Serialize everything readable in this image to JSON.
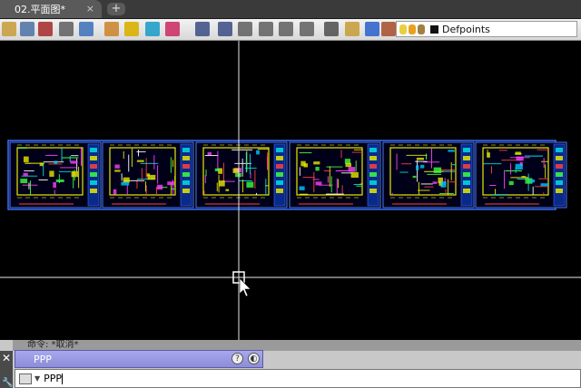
{
  "tabs": {
    "document_tab": "02.平面图*",
    "close_glyph": "×",
    "new_tab_glyph": "+"
  },
  "toolbar": {
    "buttons": [
      {
        "name": "open-icon",
        "color": "#c8a040"
      },
      {
        "name": "save-icon",
        "color": "#5577aa"
      },
      {
        "name": "block-icon",
        "color": "#aa3333"
      },
      {
        "name": "properties-icon",
        "color": "#666666"
      },
      {
        "name": "table-icon",
        "color": "#4477bb"
      },
      {
        "name": "edit-icon",
        "color": "#cc8833"
      },
      {
        "name": "text-icon",
        "color": "#d8b000"
      },
      {
        "name": "hatch-icon",
        "color": "#22a0c8"
      },
      {
        "name": "image-icon",
        "color": "#cc3366"
      },
      {
        "name": "undo-icon",
        "color": "#445588"
      },
      {
        "name": "redo-icon",
        "color": "#445588"
      },
      {
        "name": "pan-icon",
        "color": "#666666"
      },
      {
        "name": "zoom-icon",
        "color": "#666666"
      },
      {
        "name": "zoom-window-icon",
        "color": "#666666"
      },
      {
        "name": "zoom-previous-icon",
        "color": "#666666"
      },
      {
        "name": "sheet-icon",
        "color": "#555555"
      },
      {
        "name": "layer-props-icon",
        "color": "#c8a040"
      },
      {
        "name": "library-icon",
        "color": "#3366cc"
      },
      {
        "name": "layer-states-icon",
        "color": "#aa5533"
      }
    ],
    "layer_icons": [
      {
        "name": "bulb-icon",
        "color": "#e8d040"
      },
      {
        "name": "sun-icon",
        "color": "#e8a020"
      },
      {
        "name": "lock-icon",
        "color": "#a08040"
      }
    ],
    "current_layer": "Defpoints"
  },
  "command_line": {
    "history": "命令: *取消*",
    "suggestion": "PPP",
    "input_value": "PPP",
    "help_glyph": "?",
    "web_glyph": "◐",
    "close_glyph": "✕",
    "settings_glyph": "🔧"
  }
}
